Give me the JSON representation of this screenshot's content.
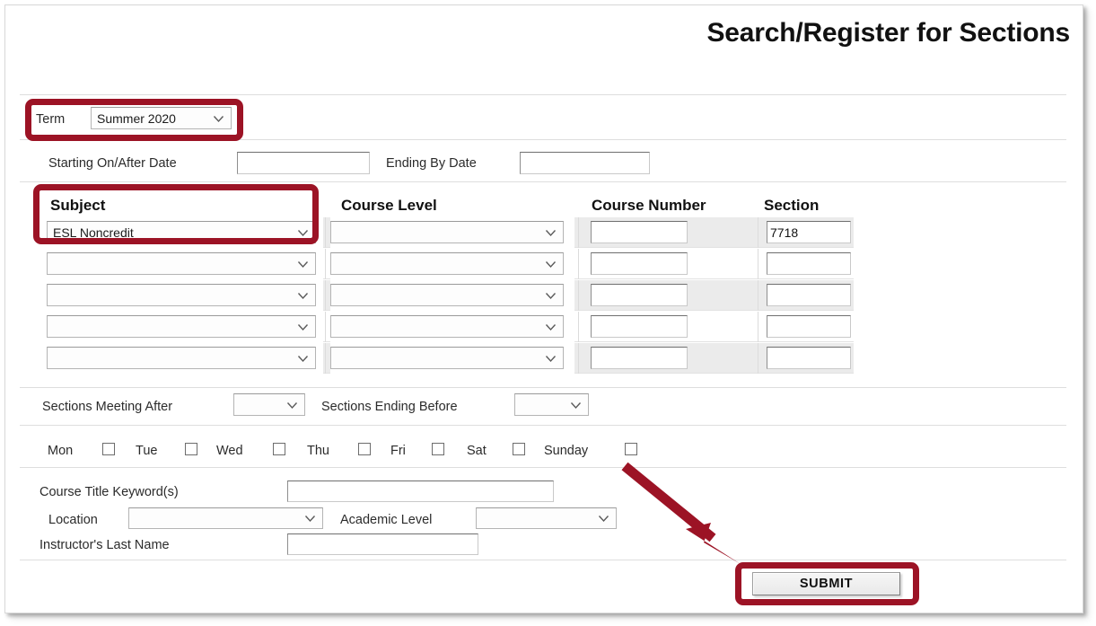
{
  "window": {
    "title": "Search/Register for Sections",
    "accent_red": "#9c1325",
    "row_shade": "#ebebeb"
  },
  "term": {
    "label": "Term",
    "value": "Summer 2020",
    "highlighted": true
  },
  "dates": {
    "start_label": "Starting On/After Date",
    "start_value": "",
    "end_label": "Ending By Date",
    "end_value": ""
  },
  "subject_grid": {
    "headers": [
      "Subject",
      "Course Level",
      "Course Number",
      "Section"
    ],
    "rows": [
      {
        "subject": "ESL Noncredit",
        "course_level": "",
        "course_number": "",
        "section": "7718",
        "section_focused": true
      },
      {
        "subject": "",
        "course_level": "",
        "course_number": "",
        "section": "",
        "section_focused": false
      },
      {
        "subject": "",
        "course_level": "",
        "course_number": "",
        "section": "",
        "section_focused": false
      },
      {
        "subject": "",
        "course_level": "",
        "course_number": "",
        "section": "",
        "section_focused": false
      },
      {
        "subject": "",
        "course_level": "",
        "course_number": "",
        "section": "",
        "section_focused": false
      }
    ]
  },
  "meeting_times": {
    "after_label": "Sections Meeting After",
    "after_value": "",
    "before_label": "Sections Ending Before",
    "before_value": ""
  },
  "days": [
    {
      "label": "Mon",
      "checked": false
    },
    {
      "label": "Tue",
      "checked": false
    },
    {
      "label": "Wed",
      "checked": false
    },
    {
      "label": "Thu",
      "checked": false
    },
    {
      "label": "Fri",
      "checked": false
    },
    {
      "label": "Sat",
      "checked": false
    },
    {
      "label": "Sunday",
      "checked": false
    }
  ],
  "extra_filters": {
    "keywords_label": "Course Title Keyword(s)",
    "keywords_value": "",
    "location_label": "Location",
    "location_value": "",
    "academic_level_label": "Academic Level",
    "academic_level_value": "",
    "instructor_label": "Instructor's Last Name",
    "instructor_value": ""
  },
  "submit": {
    "label": "SUBMIT",
    "highlighted": true
  },
  "icons": {
    "chevron": "chevron-down-icon",
    "arrow": "annotation-arrow-icon"
  }
}
